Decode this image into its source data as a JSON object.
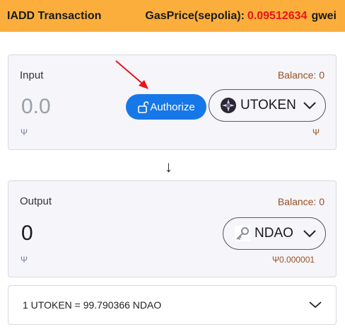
{
  "header": {
    "title": "IADD Transaction",
    "gas_label": "GasPrice(sepolia):",
    "gas_value": "0.09512634",
    "gas_unit": "gwei"
  },
  "input": {
    "label": "Input",
    "balance": "Balance: 0",
    "amount": "0.0",
    "authorize_label": "Authorize",
    "token": "UTOKEN",
    "left_symbol": "Ψ",
    "right_symbol": "Ψ"
  },
  "swap_arrow": "↓",
  "output": {
    "label": "Output",
    "balance": "Balance: 0",
    "amount": "0",
    "token": "NDAO",
    "left_symbol": "Ψ",
    "right_value": "Ψ0.000001"
  },
  "rate": {
    "text": "1 UTOKEN = 99.790366 NDAO"
  },
  "colors": {
    "header_bg": "#fbae3c",
    "gas_value": "#e8141b",
    "authorize_bg": "#1677e8",
    "balance_text": "#9a4f23",
    "annotation_arrow": "#e8141b"
  }
}
